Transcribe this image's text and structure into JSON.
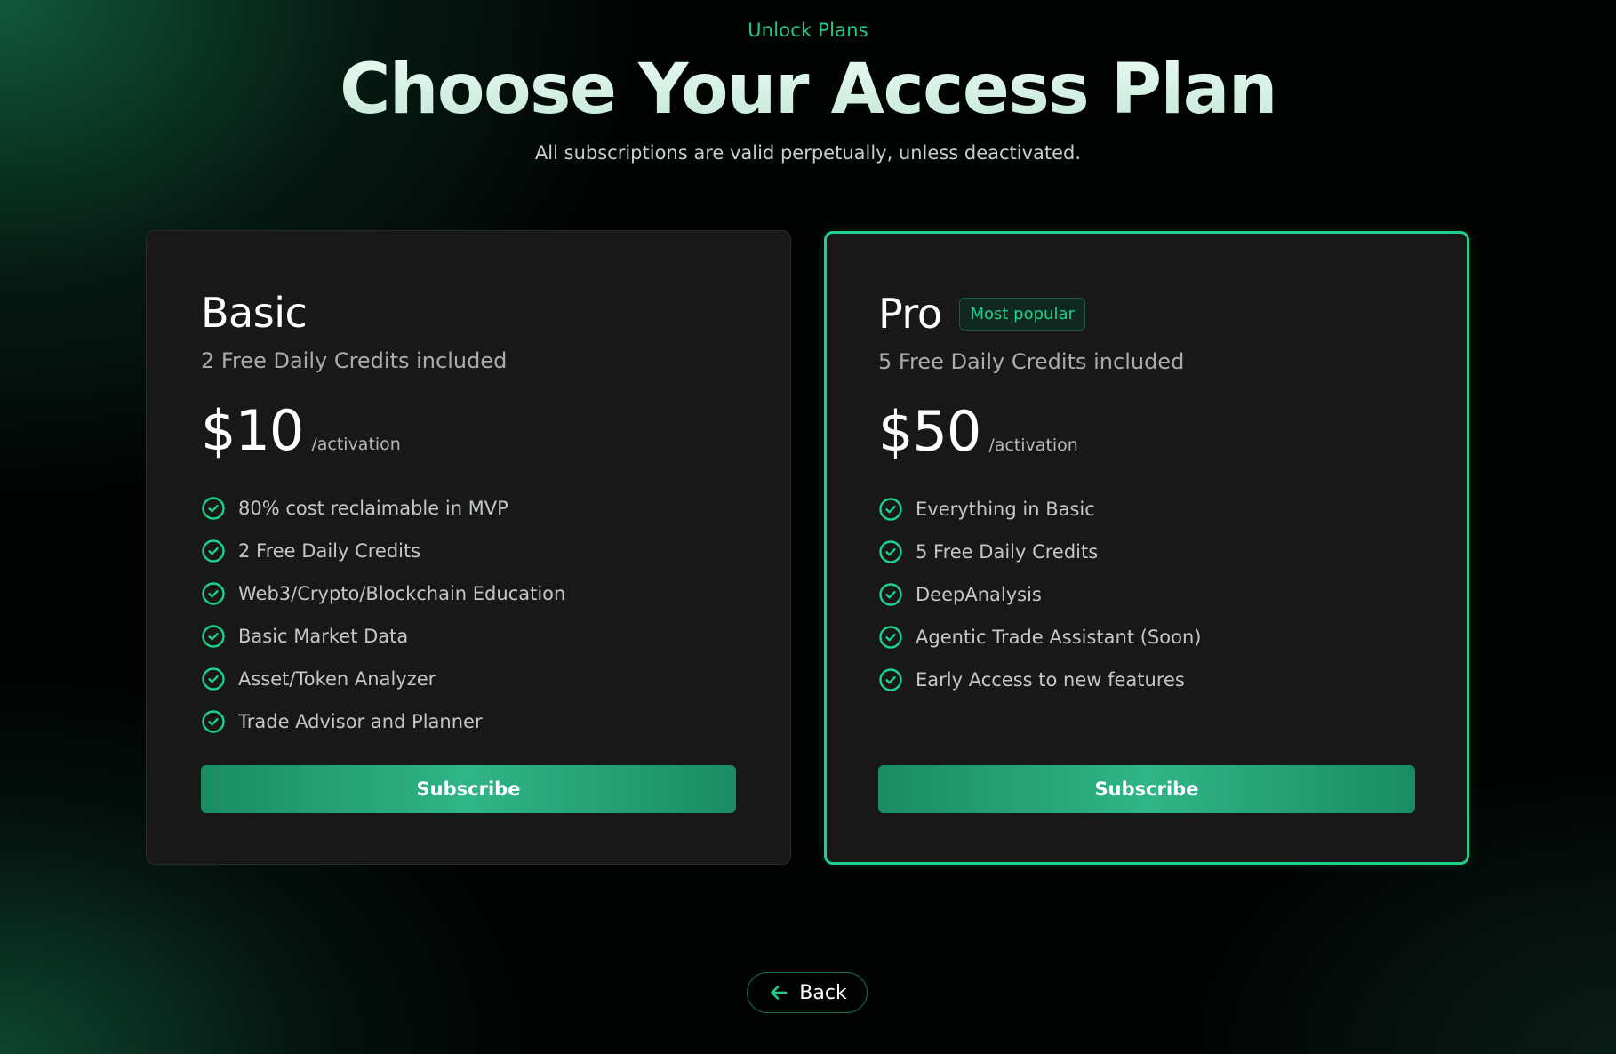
{
  "header": {
    "eyebrow": "Unlock Plans",
    "title": "Choose Your Access Plan",
    "subtitle": "All subscriptions are valid perpetually, unless deactivated."
  },
  "plans": [
    {
      "name": "Basic",
      "credits": "2 Free Daily Credits included",
      "price": "$10",
      "period": "/activation",
      "features": [
        "80% cost reclaimable in MVP",
        "2 Free Daily Credits",
        "Web3/Crypto/Blockchain Education",
        "Basic Market Data",
        "Asset/Token Analyzer",
        "Trade Advisor and Planner"
      ],
      "cta": "Subscribe"
    },
    {
      "name": "Pro",
      "badge": "Most popular",
      "credits": "5 Free Daily Credits included",
      "price": "$50",
      "period": "/activation",
      "features": [
        "Everything in Basic",
        "5 Free Daily Credits",
        "DeepAnalysis",
        "Agentic Trade Assistant (Soon)",
        "Early Access to new features"
      ],
      "cta": "Subscribe"
    }
  ],
  "footer": {
    "back_label": "Back"
  },
  "colors": {
    "accent": "#1fcf8c",
    "card_bg": "#181818",
    "button": "#2fb586"
  },
  "icons": {
    "feature": "check-circle-icon",
    "back": "arrow-left-icon"
  }
}
